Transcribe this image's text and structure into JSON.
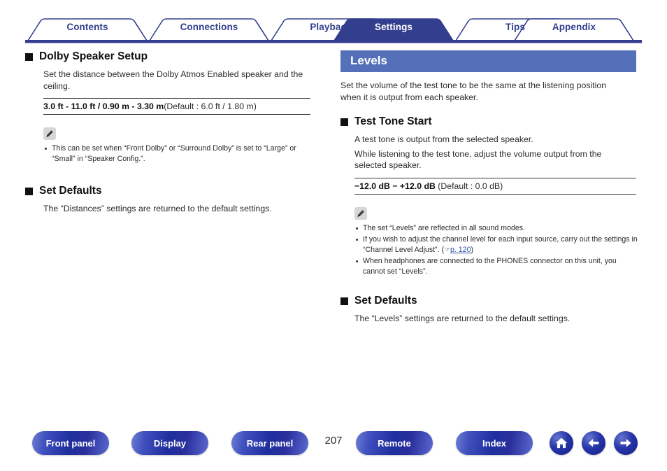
{
  "tabs": [
    {
      "label": "Contents",
      "active": false
    },
    {
      "label": "Connections",
      "active": false
    },
    {
      "label": "Playback",
      "active": false
    },
    {
      "label": "Settings",
      "active": true
    },
    {
      "label": "Tips",
      "active": false
    },
    {
      "label": "Appendix",
      "active": false
    }
  ],
  "left": {
    "section1": {
      "heading": "Dolby Speaker Setup",
      "paragraph": "Set the distance between the Dolby Atmos Enabled speaker and the ceiling.",
      "spec_bold": "3.0 ft - 11.0 ft / 0.90 m - 3.30 m",
      "spec_rest": "(Default : 6.0 ft / 1.80 m)",
      "note_icon": "pencil-icon",
      "notes": [
        "This can be set when “Front Dolby” or “Surround Dolby” is set to “Large” or “Small” in “Speaker Config.”."
      ]
    },
    "section2": {
      "heading": "Set Defaults",
      "paragraph": "The “Distances” settings are returned to the default settings."
    }
  },
  "right": {
    "banner": "Levels",
    "banner_paragraph": "Set the volume of the test tone to be the same at the listening position when it is output from each speaker.",
    "section1": {
      "heading": "Test Tone Start",
      "paragraph1": "A test tone is output from the selected speaker.",
      "paragraph2": "While listening to the test tone, adjust the volume output from the selected speaker.",
      "spec_bold": "−12.0 dB − +12.0 dB",
      "spec_rest": "(Default : 0.0 dB)",
      "note_icon": "pencil-icon",
      "notes": [
        {
          "text": "The set “Levels” are reflected in all sound modes."
        },
        {
          "text_before": "If you wish to adjust the channel level for each input source, carry out the settings in “Channel Level Adjust”.  (",
          "link_icon": "pointing-hand-icon",
          "link": "p. 120",
          "text_after": ")"
        },
        {
          "text": "When headphones are connected to the PHONES connector on this unit, you cannot set “Levels”."
        }
      ]
    },
    "section2": {
      "heading": "Set Defaults",
      "paragraph": "The “Levels” settings are returned to the default settings."
    }
  },
  "footer": {
    "buttons": [
      {
        "label": "Front panel"
      },
      {
        "label": "Display"
      },
      {
        "label": "Rear panel"
      },
      {
        "label": "Remote"
      },
      {
        "label": "Index"
      }
    ],
    "page_number": "207",
    "icons": [
      "home-icon",
      "back-arrow-icon",
      "forward-arrow-icon"
    ]
  },
  "colors": {
    "tab_blue": "#333f8e",
    "banner_blue": "#5470b8",
    "link_blue": "#2f4fa8"
  }
}
